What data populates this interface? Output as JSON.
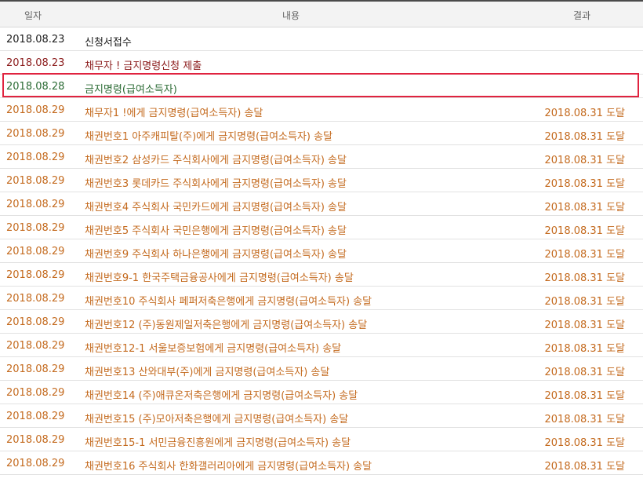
{
  "header": {
    "date": "일자",
    "content": "내용",
    "result": "결과"
  },
  "rows": [
    {
      "date": "2018.08.23",
      "content": "신청서접수",
      "result": ""
    },
    {
      "date": "2018.08.23",
      "content": "채무자        ! 금지명령신청 제출",
      "result": ""
    },
    {
      "date": "2018.08.28",
      "content": "금지명령(급여소득자)",
      "result": ""
    },
    {
      "date": "2018.08.29",
      "content": "채무자1         !에게 금지명령(급여소득자) 송달",
      "result": "2018.08.31 도달"
    },
    {
      "date": "2018.08.29",
      "content": "채권번호1 아주캐피탈(주)에게 금지명령(급여소득자) 송달",
      "result": "2018.08.31 도달"
    },
    {
      "date": "2018.08.29",
      "content": "채권번호2 삼성카드 주식회사에게 금지명령(급여소득자) 송달",
      "result": "2018.08.31 도달"
    },
    {
      "date": "2018.08.29",
      "content": "채권번호3 롯데카드 주식회사에게 금지명령(급여소득자) 송달",
      "result": "2018.08.31 도달"
    },
    {
      "date": "2018.08.29",
      "content": "채권번호4 주식회사 국민카드에게 금지명령(급여소득자) 송달",
      "result": "2018.08.31 도달"
    },
    {
      "date": "2018.08.29",
      "content": "채권번호5 주식회사 국민은행에게 금지명령(급여소득자) 송달",
      "result": "2018.08.31 도달"
    },
    {
      "date": "2018.08.29",
      "content": "채권번호9 주식회사 하나은행에게 금지명령(급여소득자) 송달",
      "result": "2018.08.31 도달"
    },
    {
      "date": "2018.08.29",
      "content": "채권번호9-1 한국주택금융공사에게 금지명령(급여소득자) 송달",
      "result": "2018.08.31 도달"
    },
    {
      "date": "2018.08.29",
      "content": "채권번호10 주식회사 페퍼저축은행에게 금지명령(급여소득자) 송달",
      "result": "2018.08.31 도달"
    },
    {
      "date": "2018.08.29",
      "content": "채권번호12 (주)동원제일저축은행에게 금지명령(급여소득자) 송달",
      "result": "2018.08.31 도달"
    },
    {
      "date": "2018.08.29",
      "content": "채권번호12-1 서울보증보험에게 금지명령(급여소득자) 송달",
      "result": "2018.08.31 도달"
    },
    {
      "date": "2018.08.29",
      "content": "채권번호13 산와대부(주)에게 금지명령(급여소득자) 송달",
      "result": "2018.08.31 도달"
    },
    {
      "date": "2018.08.29",
      "content": "채권번호14 (주)애큐온저축은행에게 금지명령(급여소득자) 송달",
      "result": "2018.08.31 도달"
    },
    {
      "date": "2018.08.29",
      "content": "채권번호15 (주)모아저축은행에게 금지명령(급여소득자) 송달",
      "result": "2018.08.31 도달"
    },
    {
      "date": "2018.08.29",
      "content": "채권번호15-1 서민금융진흥원에게 금지명령(급여소득자) 송달",
      "result": "2018.08.31 도달"
    },
    {
      "date": "2018.08.29",
      "content": "채권번호16 주식회사 한화갤러리아에게 금지명령(급여소득자) 송달",
      "result": "2018.08.31 도달"
    }
  ],
  "colors": {
    "highlight_border": "#e0233f",
    "orange_text": "#c46a1e",
    "green_text": "#2b6b34",
    "red_text": "#8b1b1b"
  }
}
